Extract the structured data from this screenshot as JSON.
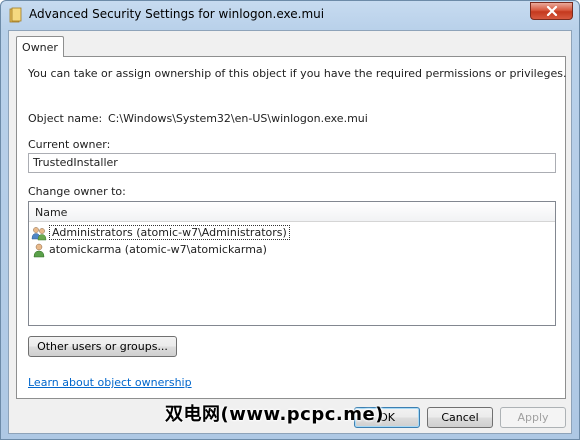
{
  "window": {
    "title": "Advanced Security Settings for winlogon.exe.mui",
    "title_icon": "folder-icon",
    "close_icon": "close-icon"
  },
  "tabs": [
    {
      "label": "Owner",
      "selected": true
    }
  ],
  "owner_panel": {
    "description": "You can take or assign ownership of this object if you have the required permissions or privileges.",
    "object_name_label": "Object name:",
    "object_name_value": "C:\\Windows\\System32\\en-US\\winlogon.exe.mui",
    "current_owner_label": "Current owner:",
    "current_owner_value": "TrustedInstaller",
    "change_owner_label": "Change owner to:",
    "list": {
      "column_header": "Name",
      "rows": [
        {
          "label": "Administrators (atomic-w7\\Administrators)",
          "icon": "group-users-icon",
          "selected": true
        },
        {
          "label": "atomickarma (atomic-w7\\atomickarma)",
          "icon": "user-icon",
          "selected": false
        }
      ]
    },
    "other_users_button": "Other users or groups...",
    "learn_link": "Learn about object ownership"
  },
  "buttons": {
    "ok": "OK",
    "cancel": "Cancel",
    "apply": "Apply"
  },
  "watermark": "双电网(www.pcpc.me)",
  "colors": {
    "frame": "#b9d1ea",
    "close_button": "#c4391e",
    "link": "#0066cc"
  }
}
